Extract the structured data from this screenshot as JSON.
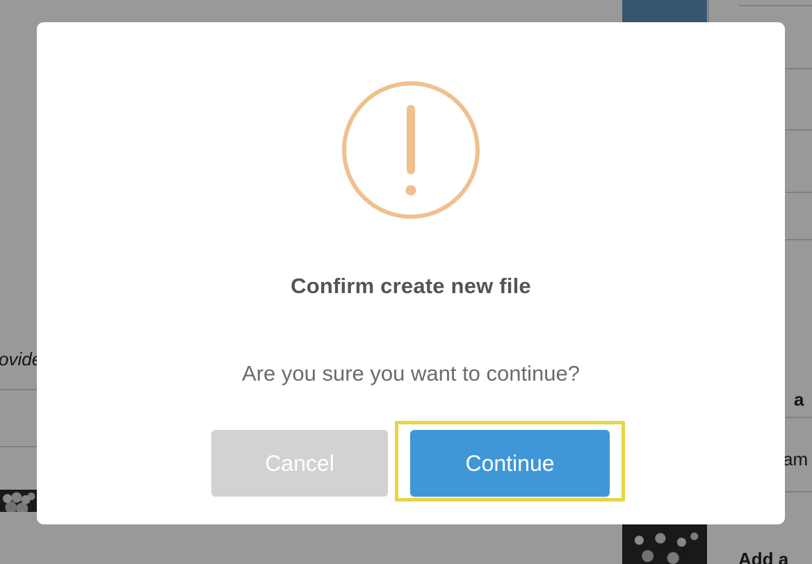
{
  "background": {
    "left_text_fragment": "ovide",
    "right_text_fragment_1": "a",
    "right_text_fragment_2": "am",
    "right_text_fragment_3": "Add a"
  },
  "dialog": {
    "icon": "exclamation-circle-icon",
    "icon_color": "#f0c08e",
    "title": "Confirm create new file",
    "message": "Are you sure you want to continue?",
    "cancel_label": "Cancel",
    "confirm_label": "Continue",
    "confirm_color": "#3f97d8",
    "cancel_color": "#d2d2d2",
    "highlight_color": "#e6d547"
  }
}
